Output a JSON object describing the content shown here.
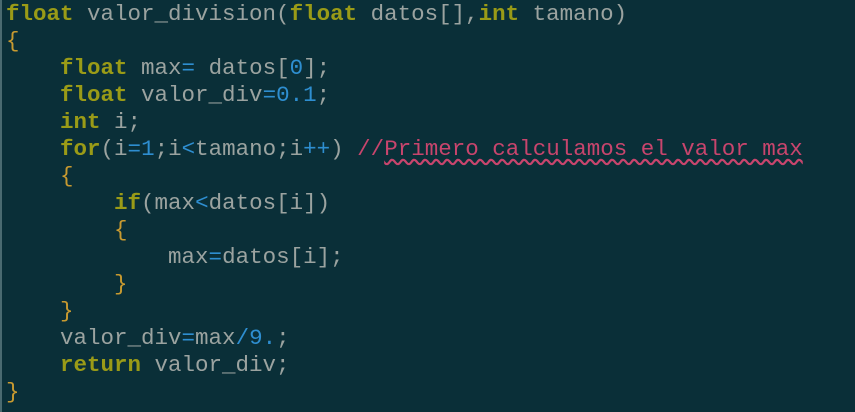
{
  "editor": {
    "lines": [
      [
        {
          "t": "float",
          "c": "kw"
        },
        {
          "t": " valor_division(",
          "c": "txt"
        },
        {
          "t": "float",
          "c": "kw"
        },
        {
          "t": " datos[],",
          "c": "txt"
        },
        {
          "t": "int",
          "c": "kw"
        },
        {
          "t": " tamano)",
          "c": "txt"
        }
      ],
      [
        {
          "t": "{",
          "c": "brace"
        }
      ],
      [
        {
          "t": "    ",
          "c": "txt"
        },
        {
          "t": "float",
          "c": "kw"
        },
        {
          "t": " max",
          "c": "txt"
        },
        {
          "t": "=",
          "c": "op"
        },
        {
          "t": " datos[",
          "c": "txt"
        },
        {
          "t": "0",
          "c": "num"
        },
        {
          "t": "];",
          "c": "txt"
        }
      ],
      [
        {
          "t": "    ",
          "c": "txt"
        },
        {
          "t": "float",
          "c": "kw"
        },
        {
          "t": " valor_div",
          "c": "txt"
        },
        {
          "t": "=",
          "c": "op"
        },
        {
          "t": "0.1",
          "c": "num"
        },
        {
          "t": ";",
          "c": "txt"
        }
      ],
      [
        {
          "t": "    ",
          "c": "txt"
        },
        {
          "t": "int",
          "c": "kw"
        },
        {
          "t": " i;",
          "c": "txt"
        }
      ],
      [
        {
          "t": "    ",
          "c": "txt"
        },
        {
          "t": "for",
          "c": "kw"
        },
        {
          "t": "(i",
          "c": "txt"
        },
        {
          "t": "=",
          "c": "op"
        },
        {
          "t": "1",
          "c": "num"
        },
        {
          "t": ";i",
          "c": "txt"
        },
        {
          "t": "<",
          "c": "op"
        },
        {
          "t": "tamano;i",
          "c": "txt"
        },
        {
          "t": "++",
          "c": "op"
        },
        {
          "t": ") ",
          "c": "txt"
        },
        {
          "t": "//",
          "c": "cm"
        },
        {
          "t": "Primero calculamos el valor max",
          "c": "cm-word"
        }
      ],
      [
        {
          "t": "    ",
          "c": "txt"
        },
        {
          "t": "{",
          "c": "brace"
        }
      ],
      [
        {
          "t": "        ",
          "c": "txt"
        },
        {
          "t": "if",
          "c": "kw"
        },
        {
          "t": "(max",
          "c": "txt"
        },
        {
          "t": "<",
          "c": "op"
        },
        {
          "t": "datos[i])",
          "c": "txt"
        }
      ],
      [
        {
          "t": "        ",
          "c": "txt"
        },
        {
          "t": "{",
          "c": "brace"
        }
      ],
      [
        {
          "t": "            max",
          "c": "txt"
        },
        {
          "t": "=",
          "c": "op"
        },
        {
          "t": "datos[i];",
          "c": "txt"
        }
      ],
      [
        {
          "t": "        ",
          "c": "txt"
        },
        {
          "t": "}",
          "c": "brace"
        }
      ],
      [
        {
          "t": "    ",
          "c": "txt"
        },
        {
          "t": "}",
          "c": "brace"
        }
      ],
      [
        {
          "t": "    valor_div",
          "c": "txt"
        },
        {
          "t": "=",
          "c": "op"
        },
        {
          "t": "max",
          "c": "txt"
        },
        {
          "t": "/",
          "c": "op"
        },
        {
          "t": "9.",
          "c": "num"
        },
        {
          "t": ";",
          "c": "txt"
        }
      ],
      [
        {
          "t": "    ",
          "c": "txt"
        },
        {
          "t": "return",
          "c": "kw"
        },
        {
          "t": " valor_div;",
          "c": "txt"
        }
      ],
      [
        {
          "t": "}",
          "c": "brace"
        }
      ]
    ],
    "colors": {
      "background": "#0a2f38",
      "keyword": "#9a9b17",
      "text": "#9ba3a0",
      "number": "#2e8ed0",
      "comment": "#c8456d",
      "brace": "#c89a30"
    }
  }
}
